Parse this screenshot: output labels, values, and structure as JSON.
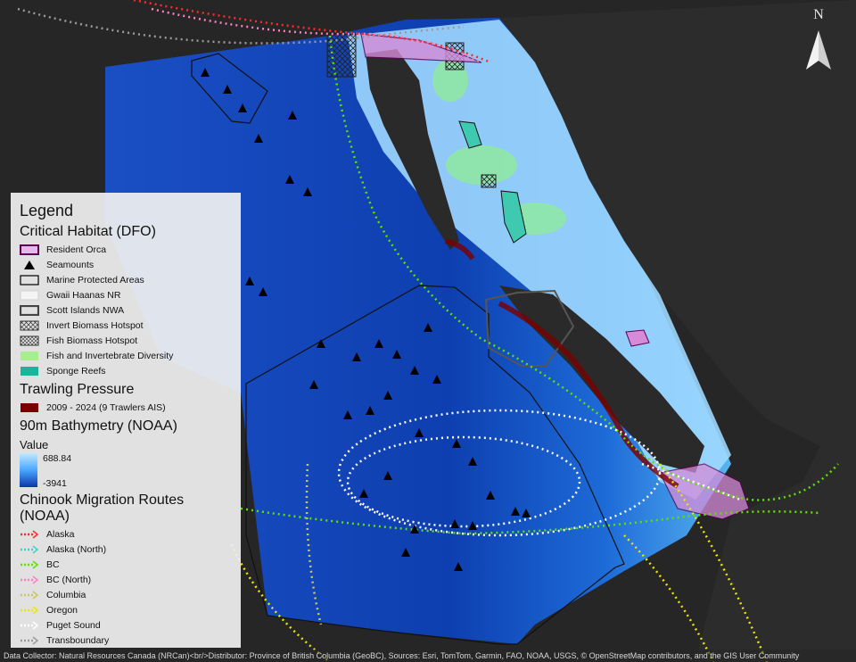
{
  "north_arrow": {
    "label": "N"
  },
  "legend": {
    "title": "Legend",
    "critical_habitat": {
      "heading": "Critical Habitat (DFO)",
      "items": [
        {
          "label": "Resident Orca",
          "symbol": "orca-habitat-swatch"
        },
        {
          "label": "Seamounts",
          "symbol": "triangle"
        },
        {
          "label": "Marine Protected Areas",
          "symbol": "outline-box"
        },
        {
          "label": "Gwaii Haanas NR",
          "symbol": "light-box"
        },
        {
          "label": "Scott Islands NWA",
          "symbol": "gray-outline-box"
        },
        {
          "label": "Invert Biomass Hotspot",
          "symbol": "crosshatch"
        },
        {
          "label": "Fish Biomass Hotspot",
          "symbol": "crosshatch-dense"
        },
        {
          "label": "Fish and Invertebrate Diversity",
          "symbol": "green-box"
        },
        {
          "label": "Sponge Reefs",
          "symbol": "teal-box"
        }
      ]
    },
    "trawling": {
      "heading": "Trawling Pressure",
      "items": [
        {
          "label": "2009 - 2024 (9 Trawlers AIS)",
          "color": "#7a0000"
        }
      ]
    },
    "bathymetry": {
      "heading": "90m Bathymetry (NOAA)",
      "value_heading": "Value",
      "max": "688.84",
      "min": "-3941"
    },
    "chinook": {
      "heading": "Chinook Migration Routes (NOAA)",
      "routes": [
        {
          "label": "Alaska",
          "color": "#ff2a2a"
        },
        {
          "label": "Alaska (North)",
          "color": "#3fd1c4"
        },
        {
          "label": "BC",
          "color": "#5fe000"
        },
        {
          "label": "BC (North)",
          "color": "#ff7fbf"
        },
        {
          "label": "Columbia",
          "color": "#c8c860"
        },
        {
          "label": "Oregon",
          "color": "#e8e800"
        },
        {
          "label": "Puget Sound",
          "color": "#ffffff"
        },
        {
          "label": "Transboundary",
          "color": "#9a9a9a"
        }
      ]
    }
  },
  "map_colors": {
    "land": "#262626",
    "deep_ocean": "#0b3aa8",
    "shallow": "#b6e4ff",
    "trawl": "#7a0000",
    "orca": "#d58bd8"
  },
  "attribution": "Data Collector: Natural Resources Canada (NRCan)<br/>Distributor: Province of British Columbia (GeoBC), Sources: Esri, TomTom, Garmin, FAO, NOAA, USGS, © OpenStreetMap contributors, and the GIS User Community"
}
